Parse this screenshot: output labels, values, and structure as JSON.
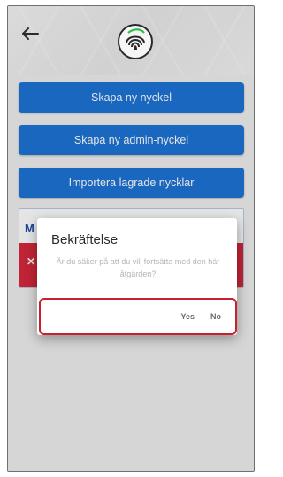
{
  "header": {
    "back_icon": "back-arrow-icon",
    "logo_icon": "fingerprint-logo-icon"
  },
  "actions": {
    "create_key": "Skapa ny nyckel",
    "create_admin_key": "Skapa ny admin-nyckel",
    "import_keys": "Importera lagrade nycklar"
  },
  "card": {
    "title_initial": "M",
    "edit_icon": "pencil-icon",
    "close_icon": "close-icon",
    "accent_color": "#d6293d"
  },
  "dialog": {
    "title": "Bekräftelse",
    "message": "Är du säker på att du vill fortsätta med den här åtgärden?",
    "yes_label": "Yes",
    "no_label": "No",
    "highlight_color": "#c9202e"
  },
  "colors": {
    "primary_button": "#1e73d6"
  }
}
